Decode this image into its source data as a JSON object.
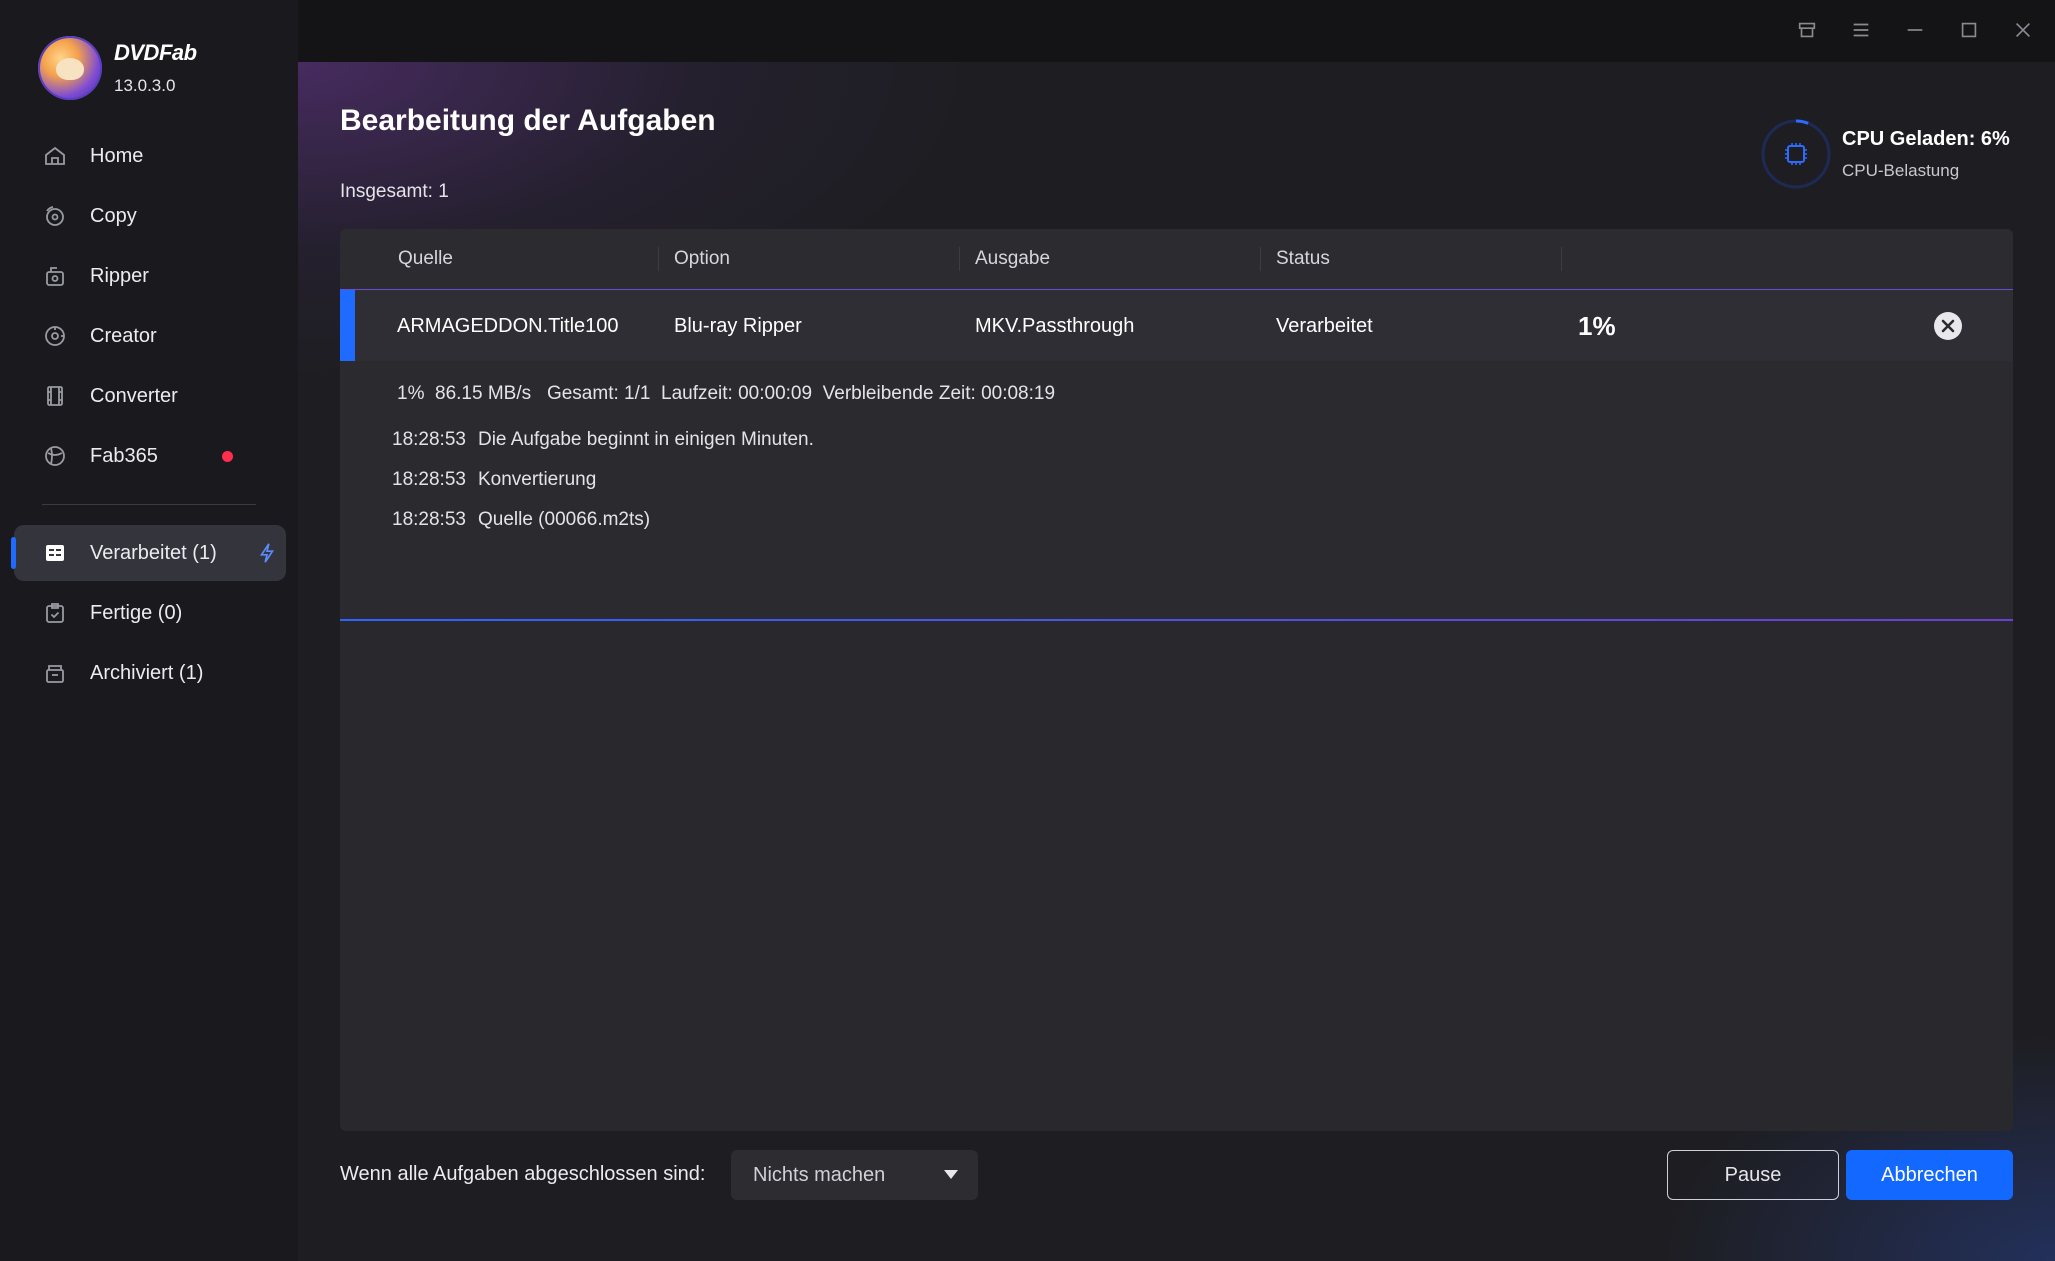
{
  "app": {
    "name": "DVDFab",
    "version": "13.0.3.0"
  },
  "sidebar": {
    "items": [
      {
        "label": "Home",
        "icon": "home-icon"
      },
      {
        "label": "Copy",
        "icon": "copy-icon"
      },
      {
        "label": "Ripper",
        "icon": "ripper-icon"
      },
      {
        "label": "Creator",
        "icon": "creator-icon"
      },
      {
        "label": "Converter",
        "icon": "converter-icon"
      },
      {
        "label": "Fab365",
        "icon": "fab365-icon",
        "notification_dot": true
      }
    ],
    "queue": [
      {
        "label": "Verarbeitet (1)",
        "icon": "processing-icon",
        "active": true
      },
      {
        "label": "Fertige (0)",
        "icon": "finished-icon"
      },
      {
        "label": "Archiviert (1)",
        "icon": "archive-icon"
      }
    ]
  },
  "titlebar": {
    "controls": [
      "store-icon",
      "menu-icon",
      "minimize-icon",
      "maximize-icon",
      "close-icon"
    ]
  },
  "main": {
    "title": "Bearbeitung der Aufgaben",
    "total": "Insgesamt: 1",
    "cpu": {
      "title": "CPU Geladen: 6%",
      "subtitle": "CPU-Belastung",
      "load_fraction": 0.06
    },
    "table": {
      "headers": [
        "Quelle",
        "Option",
        "Ausgabe",
        "Status"
      ],
      "row": {
        "source": "ARMAGEDDON.Title100",
        "option": "Blu-ray Ripper",
        "output": "MKV.Passthrough",
        "status": "Verarbeitet",
        "percent": "1%"
      },
      "detail": {
        "stats": "1%  86.15 MB/s   Gesamt: 1/1  Laufzeit: 00:00:09  Verbleibende Zeit: 00:08:19",
        "log": [
          {
            "time": "18:28:53",
            "message": "Die Aufgabe beginnt in einigen Minuten."
          },
          {
            "time": "18:28:53",
            "message": "Konvertierung"
          },
          {
            "time": "18:28:53",
            "message": "Quelle (00066.m2ts)"
          }
        ]
      }
    }
  },
  "footer": {
    "label": "Wenn alle Aufgaben abgeschlossen sind:",
    "select_value": "Nichts machen",
    "pause_label": "Pause",
    "cancel_label": "Abbrechen"
  },
  "colors": {
    "accent": "#1268ff",
    "notification": "#ff2e4d",
    "sidebar_bg": "#1a1a1e",
    "main_bg": "#1e1e22"
  }
}
